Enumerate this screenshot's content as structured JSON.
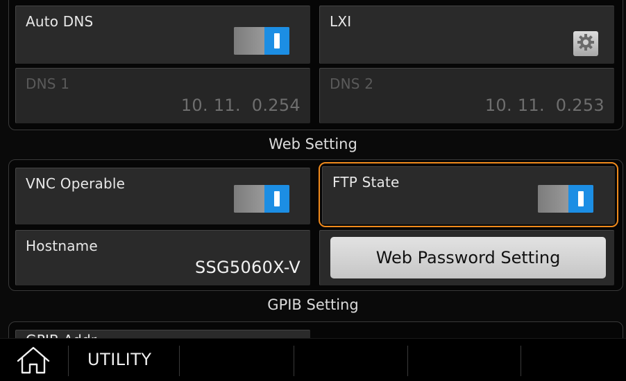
{
  "network": {
    "auto_dns": {
      "label": "Auto DNS",
      "state": "on"
    },
    "lxi": {
      "label": "LXI",
      "icon": "gear-icon"
    },
    "dns1": {
      "label": "DNS 1",
      "value": "10. 11.  0.254"
    },
    "dns2": {
      "label": "DNS 2",
      "value": "10. 11.  0.253"
    }
  },
  "web": {
    "section_title": "Web Setting",
    "vnc_operable": {
      "label": "VNC Operable",
      "state": "on"
    },
    "ftp_state": {
      "label": "FTP State",
      "state": "on"
    },
    "hostname": {
      "label": "Hostname",
      "value": "SSG5060X-V"
    },
    "password_button": "Web Password Setting"
  },
  "gpib": {
    "section_title": "GPIB Setting",
    "address_label_partial": "GPIB Addr"
  },
  "bottom_bar": {
    "home_icon": "home-icon",
    "label": "UTILITY"
  },
  "colors": {
    "accent_blue": "#1c8ee4",
    "focus_orange": "#f08a1c",
    "background": "#0a0a0a",
    "cell": "#2a2a2a"
  }
}
